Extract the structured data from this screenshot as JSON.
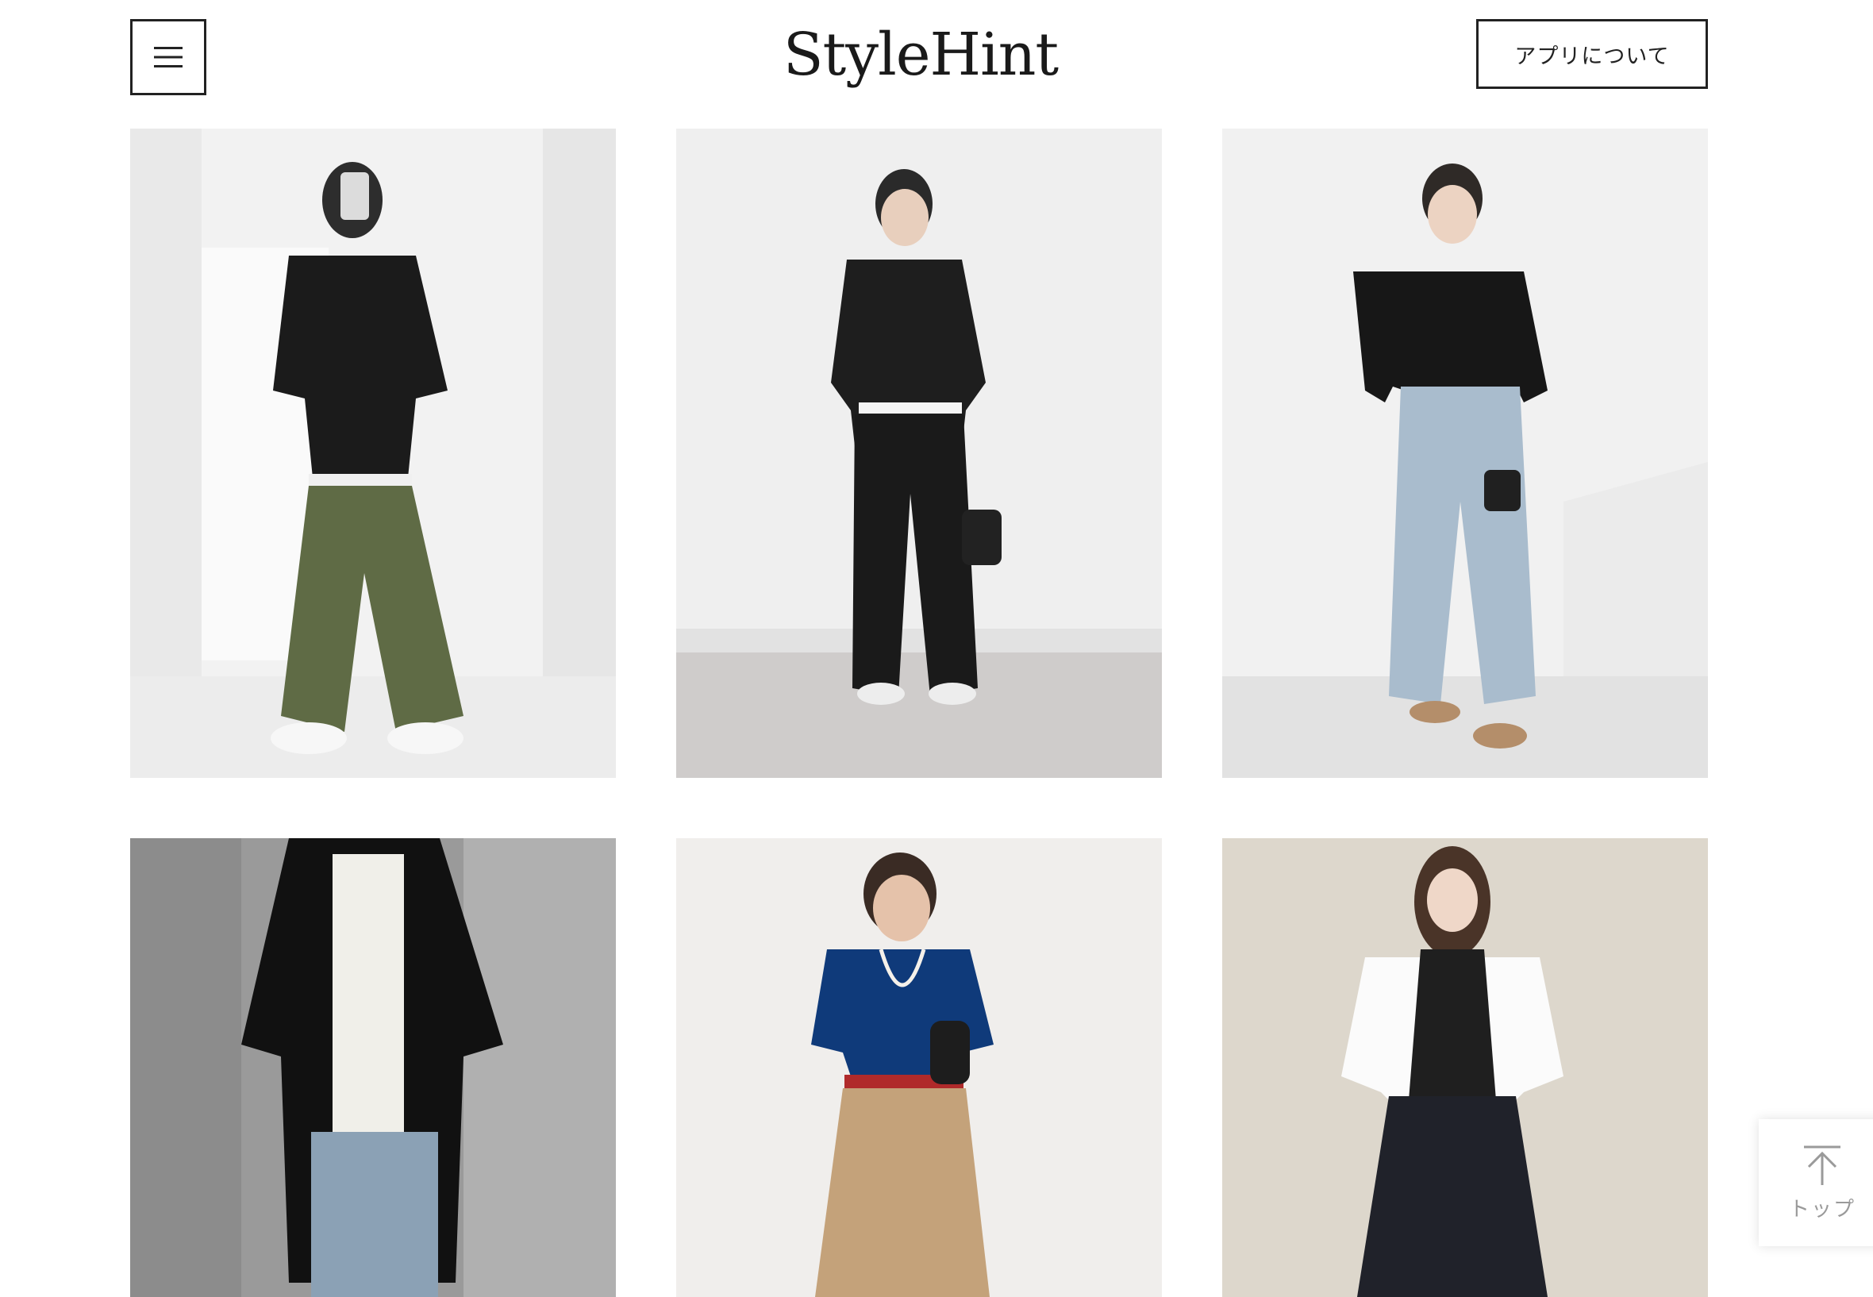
{
  "header": {
    "logo_text": "StyleHint",
    "menu_icon": "hamburger-menu-icon",
    "about_label": "アプリについて"
  },
  "grid": {
    "items": [
      {
        "alt": "outfit-photo-1"
      },
      {
        "alt": "outfit-photo-2"
      },
      {
        "alt": "outfit-photo-3"
      },
      {
        "alt": "outfit-photo-4"
      },
      {
        "alt": "outfit-photo-5"
      },
      {
        "alt": "outfit-photo-6"
      }
    ]
  },
  "back_to_top": {
    "icon": "arrow-up-icon",
    "label": "トップ"
  },
  "colors": {
    "border": "#222222",
    "muted": "#9a9a9a"
  }
}
